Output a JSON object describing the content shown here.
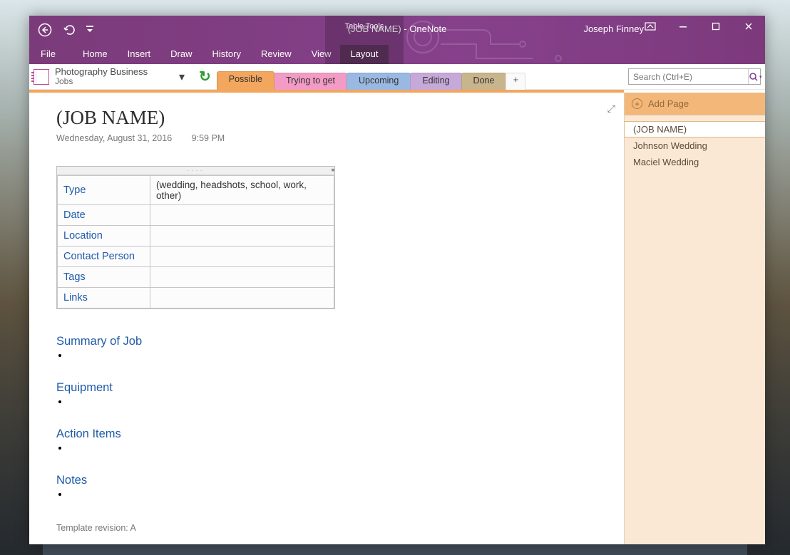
{
  "app": {
    "title_doc": "(JOB NAME)",
    "title_app": "OneNote",
    "title_sep": "  -  ",
    "user": "Joseph Finney",
    "table_tools_label": "Table Tools"
  },
  "ribbon": {
    "file": "File",
    "tabs": [
      "Home",
      "Insert",
      "Draw",
      "History",
      "Review",
      "View"
    ],
    "layout": "Layout"
  },
  "notebook": {
    "name": "Photography Business",
    "section": "Jobs"
  },
  "section_tabs": [
    {
      "label": "Possible",
      "bg": "#f2a65e",
      "active": true
    },
    {
      "label": "Trying to get",
      "bg": "#f29bc5",
      "active": false
    },
    {
      "label": "Upcoming",
      "bg": "#9ab9e2",
      "active": false
    },
    {
      "label": "Editing",
      "bg": "#c7a9d9",
      "active": false
    },
    {
      "label": "Done",
      "bg": "#c8b58b",
      "active": false
    }
  ],
  "search": {
    "placeholder": "Search (Ctrl+E)"
  },
  "addpage_label": "Add Page",
  "pages": [
    {
      "title": "(JOB NAME)",
      "active": true
    },
    {
      "title": "Johnson Wedding",
      "active": false
    },
    {
      "title": "Maciel  Wedding",
      "active": false
    }
  ],
  "page": {
    "title": "(JOB NAME)",
    "date": "Wednesday, August 31, 2016",
    "time": "9:59 PM",
    "table": [
      {
        "label": "Type",
        "value": "(wedding, headshots, school, work, other)"
      },
      {
        "label": "Date",
        "value": ""
      },
      {
        "label": "Location",
        "value": ""
      },
      {
        "label": "Contact Person",
        "value": ""
      },
      {
        "label": "Tags",
        "value": ""
      },
      {
        "label": "Links",
        "value": ""
      }
    ],
    "sections": [
      "Summary of Job",
      "Equipment",
      "Action Items",
      "Notes"
    ],
    "template_rev": "Template revision: A"
  }
}
